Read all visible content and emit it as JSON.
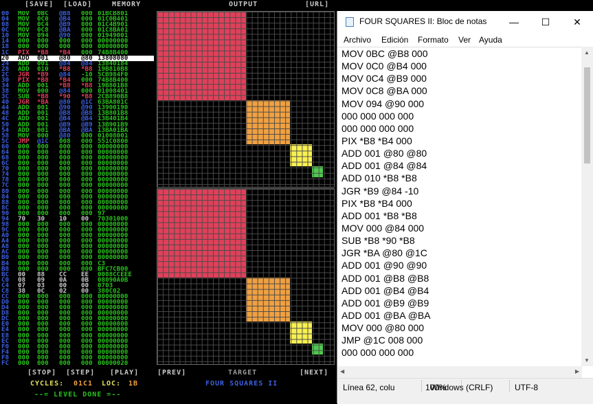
{
  "game": {
    "topbar": {
      "save": "[SAVE]",
      "load": "[LOAD]",
      "memory": "MEMORY",
      "output": "OUTPUT",
      "url": "[URL]"
    },
    "rows": [
      {
        "addr": "00",
        "op": "MOV",
        "opc": "#27c21b",
        "a": "0BC",
        "ac": "#27c21b",
        "b": "@B8",
        "bc": "#3c5fe0",
        "c": "000",
        "cc": "#27c21b",
        "mem": "01BCB801"
      },
      {
        "addr": "04",
        "op": "MOV",
        "opc": "#27c21b",
        "a": "0C0",
        "ac": "#27c21b",
        "b": "@B4",
        "bc": "#3c5fe0",
        "c": "000",
        "cc": "#27c21b",
        "mem": "01C0B401"
      },
      {
        "addr": "08",
        "op": "MOV",
        "opc": "#27c21b",
        "a": "0C4",
        "ac": "#27c21b",
        "b": "@B9",
        "bc": "#3c5fe0",
        "c": "000",
        "cc": "#27c21b",
        "mem": "01C4B901"
      },
      {
        "addr": "0C",
        "op": "MOV",
        "opc": "#27c21b",
        "a": "0C8",
        "ac": "#27c21b",
        "b": "@BA",
        "bc": "#3c5fe0",
        "c": "000",
        "cc": "#27c21b",
        "mem": "01C8BA01"
      },
      {
        "addr": "10",
        "op": "MOV",
        "opc": "#27c21b",
        "a": "094",
        "ac": "#27c21b",
        "b": "@90",
        "bc": "#3c5fe0",
        "c": "000",
        "cc": "#27c21b",
        "mem": "01949001"
      },
      {
        "addr": "14",
        "op": "000",
        "opc": "#27c21b",
        "a": "000",
        "ac": "#27c21b",
        "b": "000",
        "bc": "#27c21b",
        "c": "000",
        "cc": "#27c21b",
        "mem": "00000000"
      },
      {
        "addr": "18",
        "op": "000",
        "opc": "#27c21b",
        "a": "000",
        "ac": "#27c21b",
        "b": "000",
        "bc": "#27c21b",
        "c": "000",
        "cc": "#27c21b",
        "mem": "00000000"
      },
      {
        "addr": "1C",
        "op": "PIX",
        "opc": "#e0405a",
        "a": "*B8",
        "ac": "#e0405a",
        "b": "*B4",
        "bc": "#e0405a",
        "c": "000",
        "cc": "#27c21b",
        "mem": "74B8B400"
      },
      {
        "addr": "20",
        "op": "ADD",
        "opc": "#27c21b",
        "a": "001",
        "ac": "#27c21b",
        "b": "@80",
        "bc": "#3c5fe0",
        "c": "@80",
        "cc": "#3c5fe0",
        "mem": "13808080",
        "hl": true
      },
      {
        "addr": "24",
        "op": "ADD",
        "opc": "#27c21b",
        "a": "001",
        "ac": "#27c21b",
        "b": "@84",
        "bc": "#3c5fe0",
        "c": "@84",
        "cc": "#3c5fe0",
        "mem": "13840184"
      },
      {
        "addr": "28",
        "op": "ADD",
        "opc": "#27c21b",
        "a": "010",
        "ac": "#27c21b",
        "b": "*B8",
        "bc": "#e0405a",
        "c": "*B8",
        "cc": "#e0405a",
        "mem": "19B810B8"
      },
      {
        "addr": "2C",
        "op": "JGR",
        "opc": "#e0405a",
        "a": "*B9",
        "ac": "#e0405a",
        "b": "@84",
        "bc": "#3c5fe0",
        "c": "-10",
        "cc": "#27c21b",
        "mem": "5CB984F0"
      },
      {
        "addr": "30",
        "op": "PIX",
        "opc": "#e0405a",
        "a": "*B8",
        "ac": "#e0405a",
        "b": "*B4",
        "bc": "#e0405a",
        "c": "000",
        "cc": "#27c21b",
        "mem": "74B8B400"
      },
      {
        "addr": "34",
        "op": "ADD",
        "opc": "#27c21b",
        "a": "001",
        "ac": "#27c21b",
        "b": "*B8",
        "bc": "#e0405a",
        "c": "*B8",
        "cc": "#e0405a",
        "mem": "19B801B8"
      },
      {
        "addr": "38",
        "op": "MOV",
        "opc": "#27c21b",
        "a": "000",
        "ac": "#27c21b",
        "b": "@84",
        "bc": "#3c5fe0",
        "c": "000",
        "cc": "#27c21b",
        "mem": "01008401"
      },
      {
        "addr": "3C",
        "op": "SUB",
        "opc": "#27c21b",
        "a": "*B8",
        "ac": "#e0405a",
        "b": "*90",
        "bc": "#e0405a",
        "c": "*B8",
        "cc": "#e0405a",
        "mem": "2CB890B8"
      },
      {
        "addr": "40",
        "op": "JGR",
        "opc": "#e0405a",
        "a": "*BA",
        "ac": "#e0405a",
        "b": "@80",
        "bc": "#3c5fe0",
        "c": "@1C",
        "cc": "#3c5fe0",
        "mem": "63BA801C"
      },
      {
        "addr": "44",
        "op": "ADD",
        "opc": "#27c21b",
        "a": "001",
        "ac": "#27c21b",
        "b": "@90",
        "bc": "#3c5fe0",
        "c": "@90",
        "cc": "#3c5fe0",
        "mem": "13900190"
      },
      {
        "addr": "48",
        "op": "ADD",
        "opc": "#27c21b",
        "a": "001",
        "ac": "#27c21b",
        "b": "@B8",
        "bc": "#3c5fe0",
        "c": "@B8",
        "cc": "#3c5fe0",
        "mem": "13B801B8"
      },
      {
        "addr": "4C",
        "op": "ADD",
        "opc": "#27c21b",
        "a": "001",
        "ac": "#27c21b",
        "b": "@B4",
        "bc": "#3c5fe0",
        "c": "@B4",
        "cc": "#3c5fe0",
        "mem": "13B401B4"
      },
      {
        "addr": "50",
        "op": "ADD",
        "opc": "#27c21b",
        "a": "001",
        "ac": "#27c21b",
        "b": "@B9",
        "bc": "#3c5fe0",
        "c": "@B9",
        "cc": "#3c5fe0",
        "mem": "13B901B9"
      },
      {
        "addr": "54",
        "op": "ADD",
        "opc": "#27c21b",
        "a": "001",
        "ac": "#27c21b",
        "b": "@BA",
        "bc": "#3c5fe0",
        "c": "@BA",
        "cc": "#3c5fe0",
        "mem": "13BA01BA"
      },
      {
        "addr": "58",
        "op": "MOV",
        "opc": "#27c21b",
        "a": "000",
        "ac": "#27c21b",
        "b": "@80",
        "bc": "#3c5fe0",
        "c": "000",
        "cc": "#27c21b",
        "mem": "01008001"
      },
      {
        "addr": "5C",
        "op": "JMP",
        "opc": "#e0405a",
        "a": "@1C",
        "ac": "#3c5fe0",
        "b": "008",
        "bc": "#27c21b",
        "c": "000",
        "cc": "#27c21b",
        "mem": "551C0800"
      },
      {
        "addr": "60",
        "op": "000",
        "opc": "#27c21b",
        "a": "000",
        "ac": "#27c21b",
        "b": "000",
        "bc": "#27c21b",
        "c": "000",
        "cc": "#27c21b",
        "mem": "00000000"
      },
      {
        "addr": "64",
        "op": "000",
        "opc": "#27c21b",
        "a": "000",
        "ac": "#27c21b",
        "b": "000",
        "bc": "#27c21b",
        "c": "000",
        "cc": "#27c21b",
        "mem": "00000000"
      },
      {
        "addr": "68",
        "op": "000",
        "opc": "#27c21b",
        "a": "000",
        "ac": "#27c21b",
        "b": "000",
        "bc": "#27c21b",
        "c": "000",
        "cc": "#27c21b",
        "mem": "00000000"
      },
      {
        "addr": "6C",
        "op": "000",
        "opc": "#27c21b",
        "a": "000",
        "ac": "#27c21b",
        "b": "000",
        "bc": "#27c21b",
        "c": "000",
        "cc": "#27c21b",
        "mem": "00000000"
      },
      {
        "addr": "70",
        "op": "000",
        "opc": "#27c21b",
        "a": "000",
        "ac": "#27c21b",
        "b": "000",
        "bc": "#27c21b",
        "c": "000",
        "cc": "#27c21b",
        "mem": "00000000"
      },
      {
        "addr": "74",
        "op": "000",
        "opc": "#27c21b",
        "a": "000",
        "ac": "#27c21b",
        "b": "000",
        "bc": "#27c21b",
        "c": "000",
        "cc": "#27c21b",
        "mem": "00000000"
      },
      {
        "addr": "78",
        "op": "000",
        "opc": "#27c21b",
        "a": "000",
        "ac": "#27c21b",
        "b": "000",
        "bc": "#27c21b",
        "c": "000",
        "cc": "#27c21b",
        "mem": "00000000"
      },
      {
        "addr": "7C",
        "op": "000",
        "opc": "#27c21b",
        "a": "000",
        "ac": "#27c21b",
        "b": "000",
        "bc": "#27c21b",
        "c": "000",
        "cc": "#27c21b",
        "mem": "00000000"
      },
      {
        "addr": "80",
        "op": "000",
        "opc": "#27c21b",
        "a": "000",
        "ac": "#27c21b",
        "b": "000",
        "bc": "#27c21b",
        "c": "000",
        "cc": "#27c21b",
        "mem": "00000000"
      },
      {
        "addr": "84",
        "op": "000",
        "opc": "#27c21b",
        "a": "000",
        "ac": "#27c21b",
        "b": "000",
        "bc": "#27c21b",
        "c": "000",
        "cc": "#27c21b",
        "mem": "00000000"
      },
      {
        "addr": "88",
        "op": "000",
        "opc": "#27c21b",
        "a": "000",
        "ac": "#27c21b",
        "b": "000",
        "bc": "#27c21b",
        "c": "000",
        "cc": "#27c21b",
        "mem": "00000000"
      },
      {
        "addr": "8C",
        "op": "000",
        "opc": "#27c21b",
        "a": "000",
        "ac": "#27c21b",
        "b": "000",
        "bc": "#27c21b",
        "c": "000",
        "cc": "#27c21b",
        "mem": "00000000"
      },
      {
        "addr": "90",
        "op": "000",
        "opc": "#27c21b",
        "a": "000",
        "ac": "#27c21b",
        "b": "000",
        "bc": "#27c21b",
        "c": "000",
        "cc": "#27c21b",
        "mem": "97"
      },
      {
        "addr": "94",
        "op": "70",
        "opc": "#c9c9c9",
        "a": "30",
        "ac": "#c9c9c9",
        "b": "10",
        "bc": "#c9c9c9",
        "c": "00",
        "cc": "#c9c9c9",
        "mem": "70301000"
      },
      {
        "addr": "98",
        "op": "000",
        "opc": "#27c21b",
        "a": "000",
        "ac": "#27c21b",
        "b": "000",
        "bc": "#27c21b",
        "c": "000",
        "cc": "#27c21b",
        "mem": "00000000"
      },
      {
        "addr": "9C",
        "op": "000",
        "opc": "#27c21b",
        "a": "000",
        "ac": "#27c21b",
        "b": "000",
        "bc": "#27c21b",
        "c": "000",
        "cc": "#27c21b",
        "mem": "00000000"
      },
      {
        "addr": "A0",
        "op": "000",
        "opc": "#27c21b",
        "a": "000",
        "ac": "#27c21b",
        "b": "000",
        "bc": "#27c21b",
        "c": "000",
        "cc": "#27c21b",
        "mem": "00000000"
      },
      {
        "addr": "A4",
        "op": "000",
        "opc": "#27c21b",
        "a": "000",
        "ac": "#27c21b",
        "b": "000",
        "bc": "#27c21b",
        "c": "000",
        "cc": "#27c21b",
        "mem": "00000000"
      },
      {
        "addr": "A8",
        "op": "000",
        "opc": "#27c21b",
        "a": "000",
        "ac": "#27c21b",
        "b": "000",
        "bc": "#27c21b",
        "c": "000",
        "cc": "#27c21b",
        "mem": "00000000"
      },
      {
        "addr": "AC",
        "op": "000",
        "opc": "#27c21b",
        "a": "000",
        "ac": "#27c21b",
        "b": "000",
        "bc": "#27c21b",
        "c": "000",
        "cc": "#27c21b",
        "mem": "00000000"
      },
      {
        "addr": "B0",
        "op": "000",
        "opc": "#27c21b",
        "a": "000",
        "ac": "#27c21b",
        "b": "000",
        "bc": "#27c21b",
        "c": "000",
        "cc": "#27c21b",
        "mem": "00000000"
      },
      {
        "addr": "B4",
        "op": "000",
        "opc": "#27c21b",
        "a": "000",
        "ac": "#27c21b",
        "b": "000",
        "bc": "#27c21b",
        "c": "000",
        "cc": "#27c21b",
        "mem": "C3"
      },
      {
        "addr": "B8",
        "op": "000",
        "opc": "#27c21b",
        "a": "000",
        "ac": "#27c21b",
        "b": "000",
        "bc": "#27c21b",
        "c": "000",
        "cc": "#27c21b",
        "mem": "BFC7CB00"
      },
      {
        "addr": "BC",
        "op": "00",
        "opc": "#c9c9c9",
        "a": "88",
        "ac": "#c9c9c9",
        "b": "CC",
        "bc": "#c9c9c9",
        "c": "EE",
        "cc": "#c9c9c9",
        "mem": "0088CCEEE"
      },
      {
        "addr": "C0",
        "op": "08",
        "opc": "#c9c9c9",
        "a": "09",
        "ac": "#c9c9c9",
        "b": "0A",
        "bc": "#c9c9c9",
        "c": "0B",
        "cc": "#c9c9c9",
        "mem": "08090A0B"
      },
      {
        "addr": "C4",
        "op": "07",
        "opc": "#c9c9c9",
        "a": "03",
        "ac": "#c9c9c9",
        "b": "00",
        "bc": "#c9c9c9",
        "c": "00",
        "cc": "#c9c9c9",
        "mem": "0703"
      },
      {
        "addr": "C8",
        "op": "38",
        "opc": "#c9c9c9",
        "a": "0C",
        "ac": "#c9c9c9",
        "b": "02",
        "bc": "#c9c9c9",
        "c": "00",
        "cc": "#c9c9c9",
        "mem": "380C02"
      },
      {
        "addr": "CC",
        "op": "000",
        "opc": "#27c21b",
        "a": "000",
        "ac": "#27c21b",
        "b": "000",
        "bc": "#27c21b",
        "c": "000",
        "cc": "#27c21b",
        "mem": "00000000"
      },
      {
        "addr": "D0",
        "op": "000",
        "opc": "#27c21b",
        "a": "000",
        "ac": "#27c21b",
        "b": "000",
        "bc": "#27c21b",
        "c": "000",
        "cc": "#27c21b",
        "mem": "00000000"
      },
      {
        "addr": "D4",
        "op": "000",
        "opc": "#27c21b",
        "a": "000",
        "ac": "#27c21b",
        "b": "000",
        "bc": "#27c21b",
        "c": "000",
        "cc": "#27c21b",
        "mem": "00000000"
      },
      {
        "addr": "D8",
        "op": "000",
        "opc": "#27c21b",
        "a": "000",
        "ac": "#27c21b",
        "b": "000",
        "bc": "#27c21b",
        "c": "000",
        "cc": "#27c21b",
        "mem": "00000000"
      },
      {
        "addr": "DC",
        "op": "000",
        "opc": "#27c21b",
        "a": "000",
        "ac": "#27c21b",
        "b": "000",
        "bc": "#27c21b",
        "c": "000",
        "cc": "#27c21b",
        "mem": "00000000"
      },
      {
        "addr": "E0",
        "op": "000",
        "opc": "#27c21b",
        "a": "000",
        "ac": "#27c21b",
        "b": "000",
        "bc": "#27c21b",
        "c": "000",
        "cc": "#27c21b",
        "mem": "00000000"
      },
      {
        "addr": "E4",
        "op": "000",
        "opc": "#27c21b",
        "a": "000",
        "ac": "#27c21b",
        "b": "000",
        "bc": "#27c21b",
        "c": "000",
        "cc": "#27c21b",
        "mem": "00000000"
      },
      {
        "addr": "E8",
        "op": "000",
        "opc": "#27c21b",
        "a": "000",
        "ac": "#27c21b",
        "b": "000",
        "bc": "#27c21b",
        "c": "000",
        "cc": "#27c21b",
        "mem": "00000000"
      },
      {
        "addr": "EC",
        "op": "000",
        "opc": "#27c21b",
        "a": "000",
        "ac": "#27c21b",
        "b": "000",
        "bc": "#27c21b",
        "c": "000",
        "cc": "#27c21b",
        "mem": "00000000"
      },
      {
        "addr": "F0",
        "op": "000",
        "opc": "#27c21b",
        "a": "000",
        "ac": "#27c21b",
        "b": "000",
        "bc": "#27c21b",
        "c": "000",
        "cc": "#27c21b",
        "mem": "00000000"
      },
      {
        "addr": "F4",
        "op": "000",
        "opc": "#27c21b",
        "a": "000",
        "ac": "#27c21b",
        "b": "000",
        "bc": "#27c21b",
        "c": "000",
        "cc": "#27c21b",
        "mem": "00000000"
      },
      {
        "addr": "F8",
        "op": "000",
        "opc": "#27c21b",
        "a": "000",
        "ac": "#27c21b",
        "b": "000",
        "bc": "#27c21b",
        "c": "000",
        "cc": "#27c21b",
        "mem": "00000000"
      },
      {
        "addr": "FC",
        "op": "000",
        "opc": "#27c21b",
        "a": "000",
        "ac": "#27c21b",
        "b": "000",
        "bc": "#27c21b",
        "c": "000",
        "cc": "#27c21b",
        "mem": "00000020"
      }
    ],
    "squares": [
      {
        "color": "#e0405a",
        "cell": 0,
        "size": 16
      },
      {
        "color": "#f0a040",
        "cell": 16,
        "size": 8
      },
      {
        "color": "#f8f050",
        "cell": 24,
        "size": 4
      },
      {
        "color": "#50c850",
        "cell": 28,
        "size": 2
      }
    ],
    "controls": {
      "stop": "[STOP]",
      "step": "[STEP]",
      "play": "[PLAY]",
      "prev": "[PREV]",
      "target": "TARGET",
      "next": "[NEXT]"
    },
    "status": {
      "cycles_label": "CYCLES:",
      "cycles": "01C1",
      "loc_label": "LOC:",
      "loc": "1B",
      "done": "--= LEVEL DONE =--",
      "puzzle_name": "FOUR SQUARES II"
    },
    "colors": {
      "green": "#27c21b",
      "blue": "#3c5fe0",
      "red": "#e0405a",
      "orange": "#f0a040",
      "yellow": "#f8f050",
      "lime": "#50c850",
      "yellow_text": "#e0e060"
    }
  },
  "notepad": {
    "title": "FOUR SQUARES II: Bloc de notas",
    "window_buttons": {
      "minimize": "—",
      "maximize": "☐",
      "close": "✕"
    },
    "menu": [
      "Archivo",
      "Edición",
      "Formato",
      "Ver",
      "Ayuda"
    ],
    "lines": [
      "MOV 0BC @B8 000",
      "MOV 0C0 @B4 000",
      "MOV 0C4 @B9 000",
      "MOV 0C8 @BA 000",
      "MOV 094 @90 000",
      "000 000 000 000",
      "000 000 000 000",
      "PIX *B8 *B4 000",
      "ADD 001 @80 @80",
      "ADD 001 @84 @84",
      "ADD 010 *B8 *B8",
      "JGR *B9 @84 -10",
      "PIX *B8 *B4 000",
      "ADD 001 *B8 *B8",
      "MOV 000 @84 000",
      "SUB *B8 *90 *B8",
      "JGR *BA @80 @1C",
      "ADD 001 @90 @90",
      "ADD 001 @B8 @B8",
      "ADD 001 @B4 @B4",
      "ADD 001 @B9 @B9",
      "ADD 001 @BA @BA",
      "MOV 000 @80 000",
      "JMP @1C 008 000",
      "000 000 000 000"
    ],
    "status": {
      "position": "Línea 62, colu",
      "zoom": "100%",
      "eol": "Windows (CRLF)",
      "encoding": "UTF-8"
    }
  }
}
